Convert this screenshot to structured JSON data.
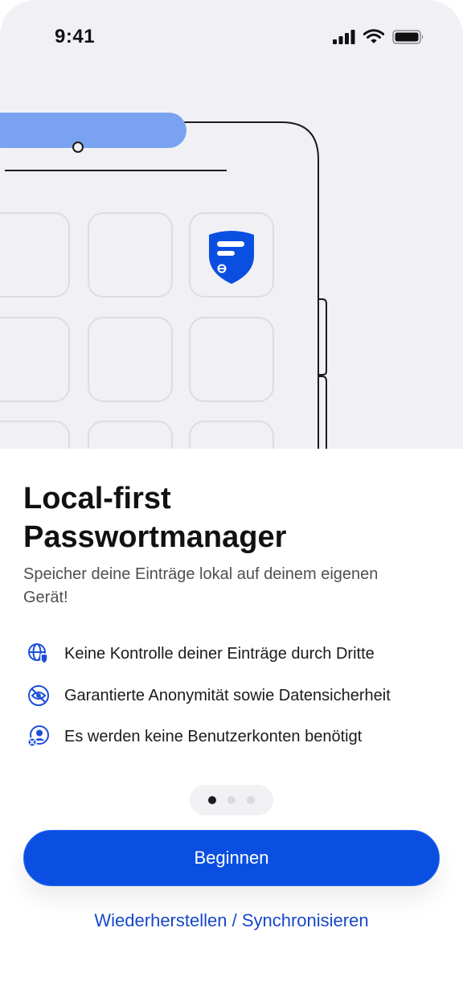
{
  "status_bar": {
    "time": "9:41",
    "icons": [
      "signal-icon",
      "wifi-icon",
      "battery-icon"
    ]
  },
  "illustration": {
    "app_icon": "shield-logo-icon"
  },
  "onboarding": {
    "title_line1": "Local-first",
    "title_line2": "Passwortmanager",
    "subtitle": "Speicher deine Einträge lokal auf deinem eigenen Gerät!",
    "features": [
      {
        "icon": "globe-shield-icon",
        "label": "Keine Kontrolle deiner Einträge durch Dritte"
      },
      {
        "icon": "eye-slash-icon",
        "label": "Garantierte Anonymität sowie Datensicherheit"
      },
      {
        "icon": "user-x-icon",
        "label": "Es werden keine Benutzerkonten benötigt"
      }
    ],
    "pager": {
      "count": 3,
      "active": 1
    },
    "primary_button": "Beginnen",
    "secondary_link": "Wiederherstellen / Synchronisieren"
  },
  "colors": {
    "accent": "#0a4fe1",
    "link": "#1647c9",
    "hero_bg": "#f1f1f5",
    "icon_blue": "#1b4fd8"
  }
}
